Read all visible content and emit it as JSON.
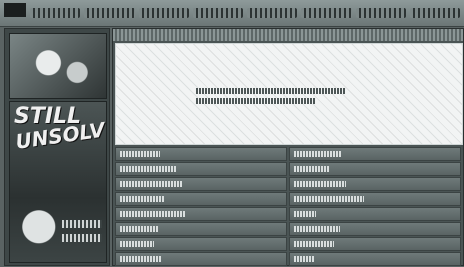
{
  "banner": {
    "logo_text": "",
    "tabs": [
      "",
      "",
      "",
      "",
      "",
      "",
      "",
      ""
    ]
  },
  "sidebar": {
    "poster_title_line1": "STILL",
    "poster_title_line2": "UNSOLVED"
  },
  "notice": {
    "line1": "",
    "line2": ""
  },
  "list": {
    "left": [
      "",
      "",
      "",
      "",
      "",
      "",
      "",
      ""
    ],
    "right": [
      "",
      "",
      "",
      "",
      "",
      "",
      "",
      ""
    ]
  }
}
